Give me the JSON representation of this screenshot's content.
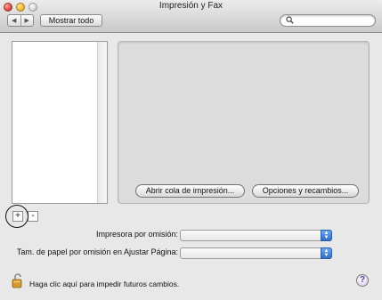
{
  "window": {
    "title": "Impresión y Fax"
  },
  "toolbar": {
    "back_icon": "◀",
    "forward_icon": "▶",
    "show_all_label": "Mostrar todo",
    "search_placeholder": "",
    "search_value": ""
  },
  "detail": {
    "open_queue_label": "Abrir cola de impresión...",
    "options_label": "Opciones y recambios..."
  },
  "list_controls": {
    "add_label": "+",
    "remove_label": "-"
  },
  "defaults": {
    "default_printer_label": "Impresora por omisión:",
    "default_printer_value": "",
    "default_paper_label": "Tam. de papel por omisión en Ajustar Página:",
    "default_paper_value": ""
  },
  "footer": {
    "lock_text": "Haga clic aquí para impedir futuros cambios.",
    "help_label": "?"
  },
  "colors": {
    "accent": "#2e6cc7"
  }
}
